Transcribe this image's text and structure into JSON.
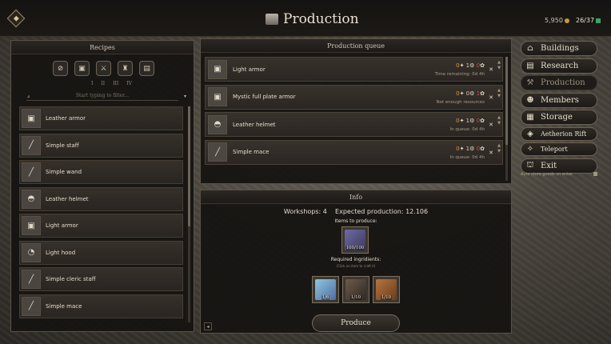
{
  "header": {
    "title": "Production",
    "gold": "5,950",
    "population": "26/37",
    "badge_icon": "crest-icon"
  },
  "recipes": {
    "title": "Recipes",
    "filters": [
      "no-filter-icon",
      "armor-icon",
      "weapon-icon",
      "trinket-icon",
      "scroll-icon"
    ],
    "tiers": [
      "I",
      "II",
      "III",
      "IV"
    ],
    "search_placeholder": "Start typing to filter...",
    "items": [
      {
        "label": "Leather armor",
        "icon": "leather-armor-icon"
      },
      {
        "label": "Simple staff",
        "icon": "staff-icon"
      },
      {
        "label": "Simple wand",
        "icon": "wand-icon"
      },
      {
        "label": "Leather helmet",
        "icon": "helmet-icon"
      },
      {
        "label": "Light armor",
        "icon": "light-armor-icon"
      },
      {
        "label": "Light hood",
        "icon": "hood-icon"
      },
      {
        "label": "Simple cleric staff",
        "icon": "cleric-staff-icon"
      },
      {
        "label": "Simple mace",
        "icon": "mace-icon"
      }
    ]
  },
  "queue": {
    "title": "Production queue",
    "items": [
      {
        "name": "Light armor",
        "c1": "0",
        "c2": "1",
        "c3": "0",
        "status": "Time remaining: 0d 4h"
      },
      {
        "name": "Mystic full plate armor",
        "c1": "0",
        "c2": "0",
        "c3": "1",
        "status": "Not enough resources"
      },
      {
        "name": "Leather helmet",
        "c1": "0",
        "c2": "1",
        "c3": "0",
        "status": "In queue: 0d 4h"
      },
      {
        "name": "Simple mace",
        "c1": "0",
        "c2": "1",
        "c3": "0",
        "status": "In queue: 0d 4h"
      }
    ]
  },
  "info": {
    "title": "Info",
    "workshops_label": "Workshops: 4",
    "expected_label": "Expected production: 12.106",
    "produce_label": "Items to produce:",
    "produce_slot_value": "100/100",
    "ingredients_label": "Required ingridients:",
    "ingredients_hint": "(Click on item to craft it)",
    "ingredients": [
      {
        "icon": "cloth-icon",
        "value": "1/6"
      },
      {
        "icon": "anvil-icon",
        "value": "1/10"
      },
      {
        "icon": "leather-icon",
        "value": "1/10"
      }
    ],
    "produce_button": "Produce"
  },
  "menu": {
    "items": [
      {
        "label": "Buildings",
        "icon": "buildings-icon"
      },
      {
        "label": "Research",
        "icon": "research-icon"
      },
      {
        "label": "Production",
        "icon": "production-icon",
        "active": true
      },
      {
        "label": "Members",
        "icon": "members-icon"
      },
      {
        "label": "Storage",
        "icon": "storage-icon"
      },
      {
        "label": "Aetherion Rift",
        "icon": "rift-icon"
      },
      {
        "label": "Teleport",
        "icon": "teleport-icon"
      },
      {
        "label": "Exit",
        "icon": "exit-icon"
      }
    ],
    "autostore_label": "Auto store goods on enter"
  }
}
